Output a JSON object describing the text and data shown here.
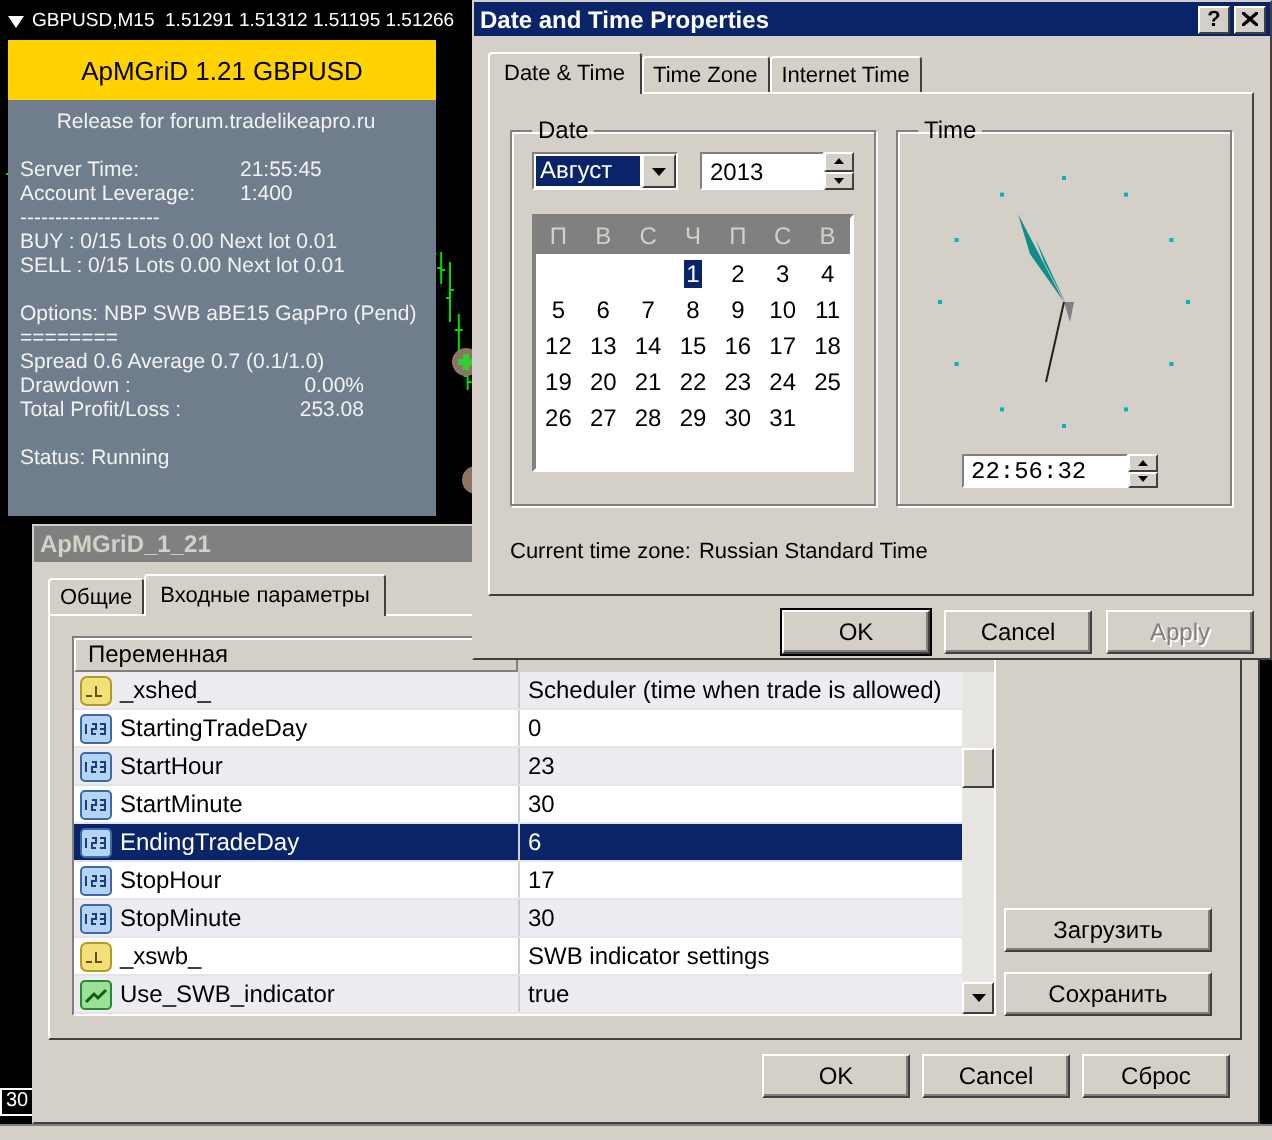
{
  "chart": {
    "header": "GBPUSD,M15  1.51291 1.51312 1.51195 1.51266",
    "axis_label": "30"
  },
  "ea_panel": {
    "title": "ApMGriD 1.21 GBPUSD",
    "sections": [
      [
        {
          "kind": "center",
          "text": "Release for forum.tradelikeapro.ru"
        }
      ],
      [
        {
          "kind": "pair",
          "label": "Server Time:",
          "value": "21:55:45"
        },
        {
          "kind": "pair",
          "label": "Account Leverage:",
          "value": "1:400"
        },
        {
          "kind": "line",
          "text": "--------------------"
        },
        {
          "kind": "line",
          "text": "BUY : 0/15  Lots 0.00 Next lot 0.01"
        },
        {
          "kind": "line",
          "text": "SELL : 0/15  Lots 0.00 Next lot 0.01"
        }
      ],
      [
        {
          "kind": "line",
          "text": "Options: NBP SWB aBE15 GapPro (Pend)"
        },
        {
          "kind": "line",
          "text": "========"
        },
        {
          "kind": "line",
          "text": "Spread 0.6 Average 0.7 (0.1/1.0)"
        },
        {
          "kind": "pair_right",
          "label": "Drawdown :",
          "value": "0.00%"
        },
        {
          "kind": "pair_right",
          "label": "Total Profit/Loss :",
          "value": "253.08"
        }
      ],
      [
        {
          "kind": "line",
          "text": "Status: Running"
        }
      ]
    ]
  },
  "date_time_dialog": {
    "title": "Date and Time Properties",
    "help_button": "?",
    "tabs": [
      {
        "label": "Date & Time",
        "selected": true
      },
      {
        "label": "Time Zone",
        "selected": false
      },
      {
        "label": "Internet Time",
        "selected": false
      }
    ],
    "date_group": {
      "legend": "Date",
      "month": "Август",
      "year": "2013",
      "weekdays": [
        "П",
        "В",
        "С",
        "Ч",
        "П",
        "С",
        "В"
      ],
      "weeks": [
        [
          {
            "day": "1",
            "selected": true
          },
          {
            "day": "2",
            "selected": false
          },
          {
            "day": "3",
            "selected": false
          },
          {
            "day": "4",
            "selected": false
          }
        ],
        [
          {
            "day": "5",
            "selected": false
          },
          {
            "day": "6",
            "selected": false
          },
          {
            "day": "7",
            "selected": false
          },
          {
            "day": "8",
            "selected": false
          },
          {
            "day": "9",
            "selected": false
          },
          {
            "day": "10",
            "selected": false
          },
          {
            "day": "11",
            "selected": false
          }
        ],
        [
          {
            "day": "12",
            "selected": false
          },
          {
            "day": "13",
            "selected": false
          },
          {
            "day": "14",
            "selected": false
          },
          {
            "day": "15",
            "selected": false
          },
          {
            "day": "16",
            "selected": false
          },
          {
            "day": "17",
            "selected": false
          },
          {
            "day": "18",
            "selected": false
          }
        ],
        [
          {
            "day": "19",
            "selected": false
          },
          {
            "day": "20",
            "selected": false
          },
          {
            "day": "21",
            "selected": false
          },
          {
            "day": "22",
            "selected": false
          },
          {
            "day": "23",
            "selected": false
          },
          {
            "day": "24",
            "selected": false
          },
          {
            "day": "25",
            "selected": false
          }
        ],
        [
          {
            "day": "26",
            "selected": false
          },
          {
            "day": "27",
            "selected": false
          },
          {
            "day": "28",
            "selected": false
          },
          {
            "day": "29",
            "selected": false
          },
          {
            "day": "30",
            "selected": false
          },
          {
            "day": "31",
            "selected": false
          }
        ]
      ]
    },
    "time_group": {
      "legend": "Time",
      "time": "22:56:32"
    },
    "time_zone": {
      "label": "Current time zone:",
      "value": "Russian Standard Time"
    },
    "buttons": [
      {
        "label": "OK",
        "default": true,
        "disabled": false
      },
      {
        "label": "Cancel",
        "default": false,
        "disabled": false
      },
      {
        "label": "Apply",
        "default": false,
        "disabled": true
      }
    ]
  },
  "ea_dialog": {
    "title": "ApMGriD_1_21",
    "tabs": [
      {
        "label": "Общие",
        "selected": false
      },
      {
        "label": "Входные параметры",
        "selected": true
      }
    ],
    "table": {
      "columns": [
        "Переменная"
      ],
      "rows": [
        {
          "kind": "string",
          "name": "_xshed_",
          "value": "Scheduler (time when trade is allowed)",
          "selected": false
        },
        {
          "kind": "integer",
          "name": "StartingTradeDay",
          "value": "0",
          "selected": false
        },
        {
          "kind": "integer",
          "name": "StartHour",
          "value": "23",
          "selected": false
        },
        {
          "kind": "integer",
          "name": "StartMinute",
          "value": "30",
          "selected": false
        },
        {
          "kind": "integer",
          "name": "EndingTradeDay",
          "value": "6",
          "selected": true
        },
        {
          "kind": "integer",
          "name": "StopHour",
          "value": "17",
          "selected": false
        },
        {
          "kind": "integer",
          "name": "StopMinute",
          "value": "30",
          "selected": false
        },
        {
          "kind": "string",
          "name": "_xswb_",
          "value": "SWB indicator settings",
          "selected": false
        },
        {
          "kind": "boolean",
          "name": "Use_SWB_indicator",
          "value": "true",
          "selected": false
        }
      ]
    },
    "side_buttons": [
      "Загрузить",
      "Сохранить"
    ],
    "buttons": [
      "OK",
      "Cancel",
      "Сброс"
    ]
  }
}
